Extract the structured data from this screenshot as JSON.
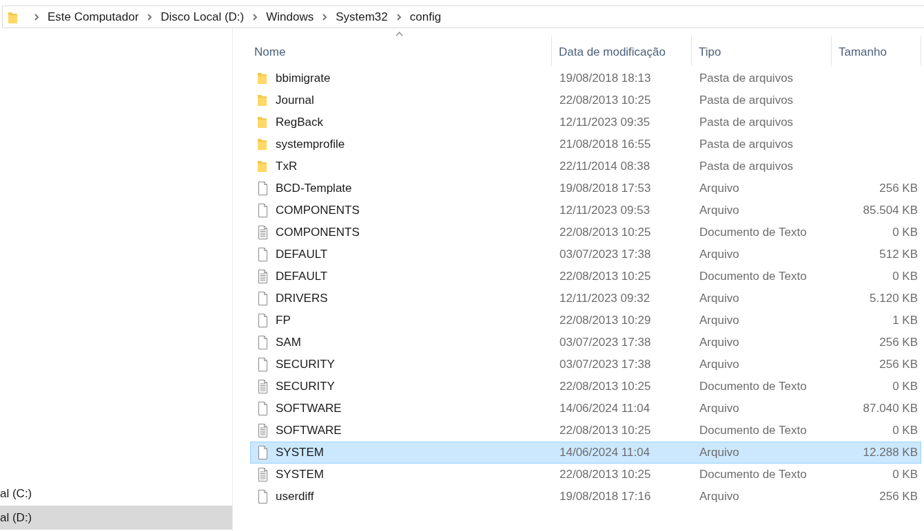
{
  "breadcrumb": [
    "Este Computador",
    "Disco Local (D:)",
    "Windows",
    "System32",
    "config"
  ],
  "nav": {
    "items": [
      {
        "label": "al (C:)",
        "selected": false
      },
      {
        "label": "al (D:)",
        "selected": true
      }
    ]
  },
  "table": {
    "columns": [
      "Nome",
      "Data de modificação",
      "Tipo",
      "Tamanho"
    ],
    "rows": [
      {
        "kind": "folder",
        "name": "bbimigrate",
        "date": "19/08/2018 18:13",
        "type": "Pasta de arquivos",
        "selected": false
      },
      {
        "kind": "folder",
        "name": "Journal",
        "date": "22/08/2013 10:25",
        "type": "Pasta de arquivos",
        "selected": false
      },
      {
        "kind": "folder",
        "name": "RegBack",
        "date": "12/11/2023 09:35",
        "type": "Pasta de arquivos",
        "selected": false
      },
      {
        "kind": "folder",
        "name": "systemprofile",
        "date": "21/08/2018 16:55",
        "type": "Pasta de arquivos",
        "selected": false
      },
      {
        "kind": "folder",
        "name": "TxR",
        "date": "22/11/2014 08:38",
        "type": "Pasta de arquivos",
        "selected": false
      },
      {
        "kind": "file",
        "name": "BCD-Template",
        "date": "19/08/2018 17:53",
        "type": "Arquivo",
        "size": "256 KB",
        "selected": false
      },
      {
        "kind": "file",
        "name": "COMPONENTS",
        "date": "12/11/2023 09:53",
        "type": "Arquivo",
        "size": "85.504 KB",
        "selected": false
      },
      {
        "kind": "text",
        "name": "COMPONENTS",
        "date": "22/08/2013 10:25",
        "type": "Documento de Texto",
        "size": "0 KB",
        "selected": false
      },
      {
        "kind": "file",
        "name": "DEFAULT",
        "date": "03/07/2023 17:38",
        "type": "Arquivo",
        "size": "512 KB",
        "selected": false
      },
      {
        "kind": "text",
        "name": "DEFAULT",
        "date": "22/08/2013 10:25",
        "type": "Documento de Texto",
        "size": "0 KB",
        "selected": false
      },
      {
        "kind": "file",
        "name": "DRIVERS",
        "date": "12/11/2023 09:32",
        "type": "Arquivo",
        "size": "5.120 KB",
        "selected": false
      },
      {
        "kind": "file",
        "name": "FP",
        "date": "22/08/2013 10:29",
        "type": "Arquivo",
        "size": "1 KB",
        "selected": false
      },
      {
        "kind": "file",
        "name": "SAM",
        "date": "03/07/2023 17:38",
        "type": "Arquivo",
        "size": "256 KB",
        "selected": false
      },
      {
        "kind": "file",
        "name": "SECURITY",
        "date": "03/07/2023 17:38",
        "type": "Arquivo",
        "size": "256 KB",
        "selected": false
      },
      {
        "kind": "text",
        "name": "SECURITY",
        "date": "22/08/2013 10:25",
        "type": "Documento de Texto",
        "size": "0 KB",
        "selected": false
      },
      {
        "kind": "file",
        "name": "SOFTWARE",
        "date": "14/06/2024 11:04",
        "type": "Arquivo",
        "size": "87.040 KB",
        "selected": false
      },
      {
        "kind": "text",
        "name": "SOFTWARE",
        "date": "22/08/2013 10:25",
        "type": "Documento de Texto",
        "size": "0 KB",
        "selected": false
      },
      {
        "kind": "file",
        "name": "SYSTEM",
        "date": "14/06/2024 11:04",
        "type": "Arquivo",
        "size": "12.288 KB",
        "selected": true
      },
      {
        "kind": "text",
        "name": "SYSTEM",
        "date": "22/08/2013 10:25",
        "type": "Documento de Texto",
        "size": "0 KB",
        "selected": false
      },
      {
        "kind": "file",
        "name": "userdiff",
        "date": "19/08/2018 17:16",
        "type": "Arquivo",
        "size": "256 KB",
        "selected": false
      }
    ]
  }
}
